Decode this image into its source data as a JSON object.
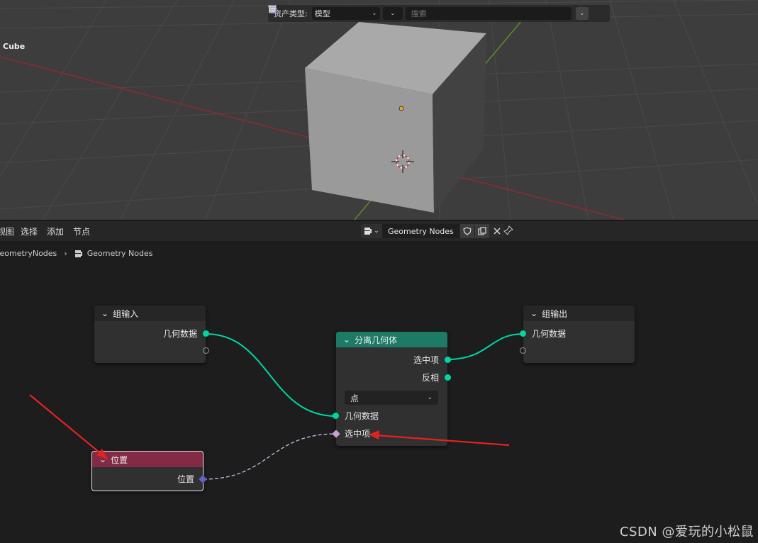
{
  "viewport": {
    "object_name": "Cube",
    "asset_bar": {
      "label": "资产类型:",
      "asset_type": "模型",
      "search_placeholder": "搜索"
    }
  },
  "editor_header": {
    "menus": [
      "视图",
      "选择",
      "添加",
      "节点"
    ],
    "node_tree_name": "Geometry Nodes"
  },
  "breadcrumb": {
    "modifier": "GeometryNodes",
    "node_tree": "Geometry Nodes"
  },
  "nodes": {
    "group_input": {
      "title": "组输入",
      "output_geometry": "几何数据"
    },
    "separate_geometry": {
      "title": "分离几何体",
      "output_selection": "选中项",
      "output_inverted": "反相",
      "domain": "点",
      "input_geometry": "几何数据",
      "input_selection": "选中项"
    },
    "group_output": {
      "title": "组输出",
      "input_geometry": "几何数据"
    },
    "position": {
      "title": "位置",
      "output_position": "位置"
    }
  },
  "colors": {
    "geometry_socket": "#00d6a3",
    "separate_header": "#1d7a65",
    "position_header": "#832a44",
    "annotation_arrow": "#e52222"
  },
  "watermark": "CSDN @爱玩的小松鼠"
}
